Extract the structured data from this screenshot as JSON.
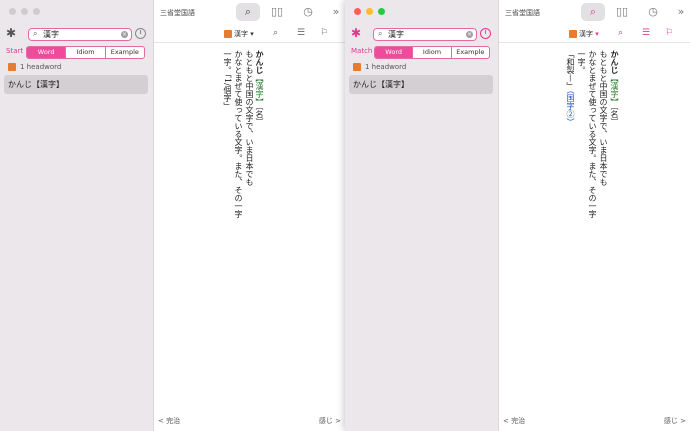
{
  "windows": [
    {
      "title": "三省堂国語",
      "mode_label": "Start",
      "search_value": "漢字",
      "tabs": [
        "Word",
        "Idiom",
        "Example"
      ],
      "headword_count": "1 headword",
      "result": "かんじ【漢字】",
      "dict_name": "漢字",
      "entry": {
        "head": "かんじ",
        "kanji": "【漢字】",
        "pos": "〔名〕",
        "def_line1": "もともと中国の文字で、いま日本でも",
        "def_line2": "かなとまぜて使っている文字。また、その一字",
        "extra_line": "一字。「1/個字」"
      },
      "footer_prev": "< 完治",
      "footer_next": "感じ >"
    },
    {
      "title": "三省堂国語",
      "mode_label": "Match",
      "search_value": "漢字",
      "tabs": [
        "Word",
        "Idiom",
        "Example"
      ],
      "headword_count": "1 headword",
      "result": "かんじ【漢字】",
      "dict_name": "漢字",
      "entry": {
        "head": "かんじ",
        "kanji": "【漢字】",
        "pos": "〔名〕",
        "def_line1": "もともと中国の文字で、いま日本でも",
        "def_line2": "かなとまぜて使っている文字。また、その一字",
        "extra_line1": "一字。",
        "extra_line2": "「和製—」",
        "extra_link": "（国字②）"
      },
      "footer_prev": "< 完治",
      "footer_next": "感じ >"
    }
  ]
}
